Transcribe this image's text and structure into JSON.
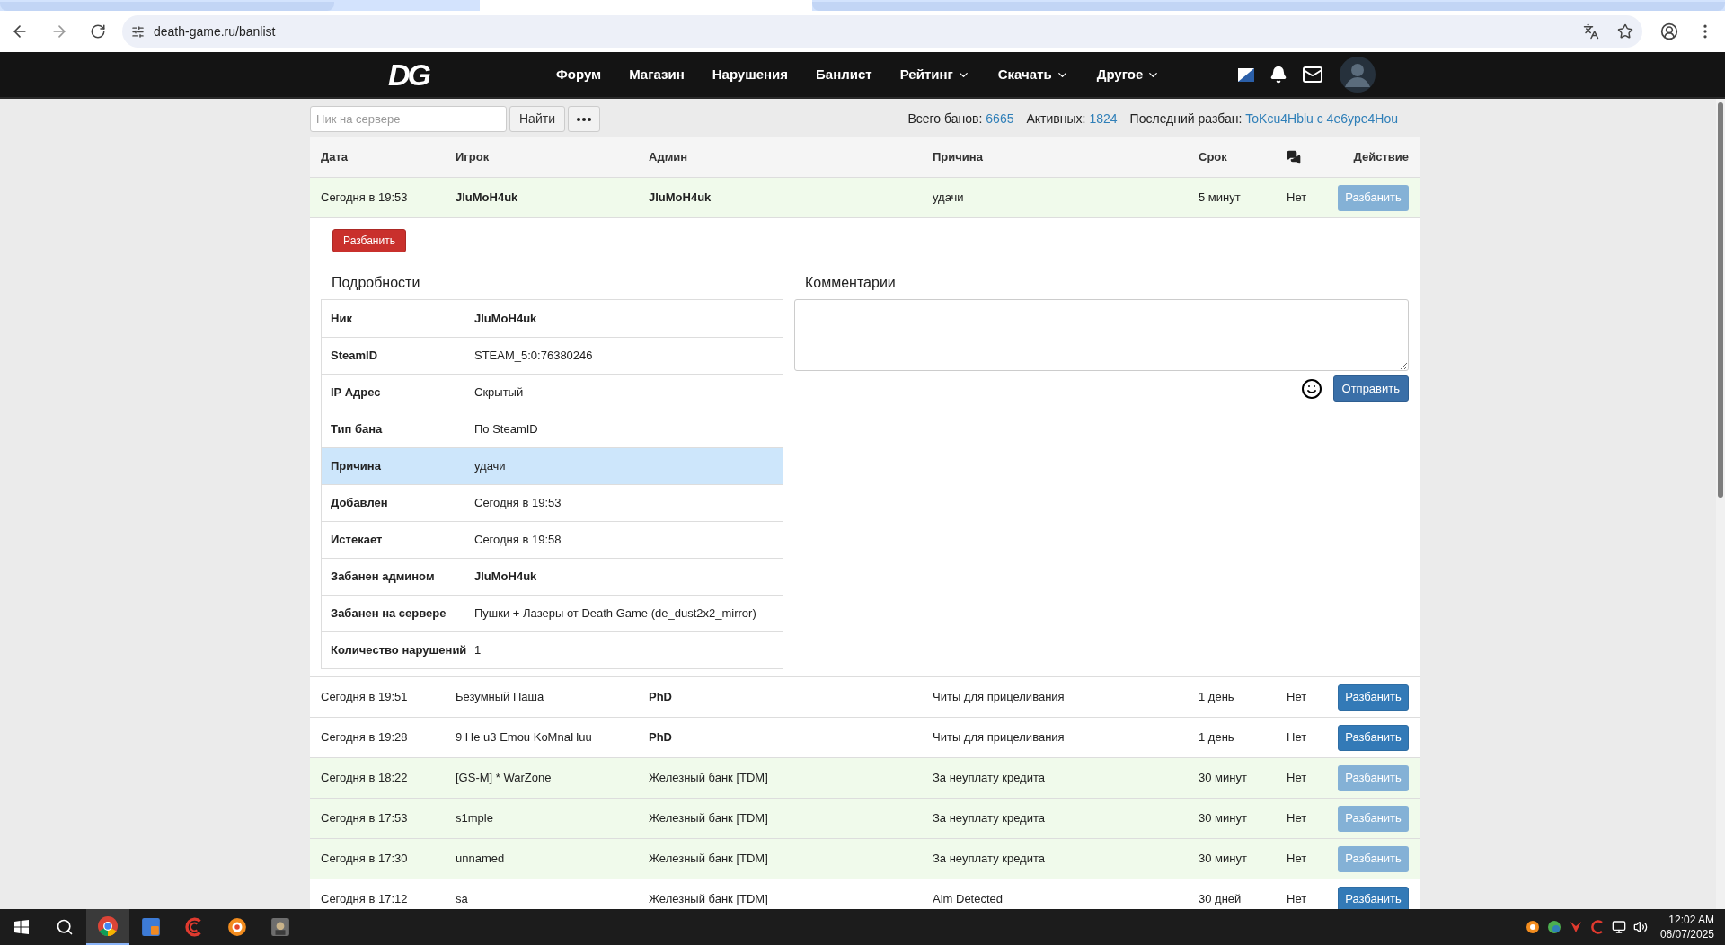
{
  "browser": {
    "url": "death-game.ru/banlist",
    "tabs": [
      {
        "selected": false
      },
      {
        "selected": true
      },
      {
        "selected": false
      }
    ]
  },
  "nav": {
    "logo": "DG",
    "items": [
      {
        "label": "Форум",
        "dropdown": false
      },
      {
        "label": "Магазин",
        "dropdown": false
      },
      {
        "label": "Нарушения",
        "dropdown": false
      },
      {
        "label": "Банлист",
        "dropdown": false
      },
      {
        "label": "Рейтинг",
        "dropdown": true
      },
      {
        "label": "Скачать",
        "dropdown": true
      },
      {
        "label": "Другое",
        "dropdown": true
      }
    ]
  },
  "toolbar": {
    "search": {
      "placeholder": "Ник на сервере"
    },
    "find_button": "Найти",
    "stats": [
      {
        "label": "Всего банов:",
        "value": "6665"
      },
      {
        "label": "Активных:",
        "value": "1824"
      },
      {
        "label": "Последний разбан:",
        "value": "ToKcu4Hblu c 4e6ype4Hou"
      }
    ]
  },
  "table": {
    "columns": [
      {
        "kind": "text",
        "label": "Дата"
      },
      {
        "kind": "text",
        "label": "Игрок"
      },
      {
        "kind": "text",
        "label": "Админ"
      },
      {
        "kind": "text",
        "label": "Причина"
      },
      {
        "kind": "text",
        "label": "Срок"
      },
      {
        "kind": "icon"
      },
      {
        "kind": "text",
        "label": "Действие"
      }
    ],
    "rows": [
      {
        "date": "Сегодня в 19:53",
        "player": "JluMoH4uk",
        "player_bold": true,
        "admin": "JluMoH4uk",
        "admin_bold": true,
        "reason": "удачи",
        "term": "5 минут",
        "comments": "Нет",
        "action": "Разбанить",
        "expired": true,
        "expanded": true
      },
      {
        "date": "Сегодня в 19:51",
        "player": "Безумный Паша",
        "player_bold": false,
        "admin": "PhD",
        "admin_bold": true,
        "reason": "Читы для прицеливания",
        "term": "1 день",
        "comments": "Нет",
        "action": "Разбанить",
        "expired": false,
        "expanded": false
      },
      {
        "date": "Сегодня в 19:28",
        "player": "9 He u3 Emou KoMnaHuu",
        "player_bold": false,
        "admin": "PhD",
        "admin_bold": true,
        "reason": "Читы для прицеливания",
        "term": "1 день",
        "comments": "Нет",
        "action": "Разбанить",
        "expired": false,
        "expanded": false
      },
      {
        "date": "Сегодня в 18:22",
        "player": "[GS-M] * WarZone",
        "player_bold": false,
        "admin": "Железный банк [TDM]",
        "admin_bold": false,
        "reason": "За неуплату кредита",
        "term": "30 минут",
        "comments": "Нет",
        "action": "Разбанить",
        "expired": true,
        "expanded": false
      },
      {
        "date": "Сегодня в 17:53",
        "player": "s1mple",
        "player_bold": false,
        "admin": "Железный банк [TDM]",
        "admin_bold": false,
        "reason": "За неуплату кредита",
        "term": "30 минут",
        "comments": "Нет",
        "action": "Разбанить",
        "expired": true,
        "expanded": false
      },
      {
        "date": "Сегодня в 17:30",
        "player": "unnamed",
        "player_bold": false,
        "admin": "Железный банк [TDM]",
        "admin_bold": false,
        "reason": "За неуплату кредита",
        "term": "30 минут",
        "comments": "Нет",
        "action": "Разбанить",
        "expired": true,
        "expanded": false
      },
      {
        "date": "Сегодня в 17:12",
        "player": "sa",
        "player_bold": false,
        "admin": "Железный банк [TDM]",
        "admin_bold": false,
        "reason": "Aim Detected",
        "term": "30 дней",
        "comments": "Нет",
        "action": "Разбанить",
        "expired": false,
        "expanded": false
      }
    ]
  },
  "details": {
    "unban_button": "Разбанить",
    "title": "Подробности",
    "rows": [
      {
        "label": "Ник",
        "value": "JluMoH4uk",
        "bold": true,
        "selected": false
      },
      {
        "label": "SteamID",
        "value": "STEAM_5:0:76380246",
        "bold": false,
        "selected": false
      },
      {
        "label": "IP Адрес",
        "value": "Скрытый",
        "bold": false,
        "selected": false
      },
      {
        "label": "Тип бана",
        "value": "По SteamID",
        "bold": false,
        "selected": false
      },
      {
        "label": "Причина",
        "value": "удачи",
        "bold": false,
        "selected": true
      },
      {
        "label": "Добавлен",
        "value": "Сегодня в 19:53",
        "bold": false,
        "selected": false
      },
      {
        "label": "Истекает",
        "value": "Сегодня в 19:58",
        "bold": false,
        "selected": false
      },
      {
        "label": "Забанен админом",
        "value": "JluMoH4uk",
        "bold": true,
        "selected": false
      },
      {
        "label": "Забанен на сервере",
        "value": "Пушки + Лазеры от Death Game (de_dust2x2_mirror)",
        "bold": false,
        "selected": false
      },
      {
        "label": "Количество нарушений",
        "value": "1",
        "bold": false,
        "selected": false
      }
    ]
  },
  "comments": {
    "title": "Комментарии",
    "send_button": "Отправить"
  },
  "taskbar": {
    "time": "12:02 AM",
    "date": "06/07/2025"
  }
}
